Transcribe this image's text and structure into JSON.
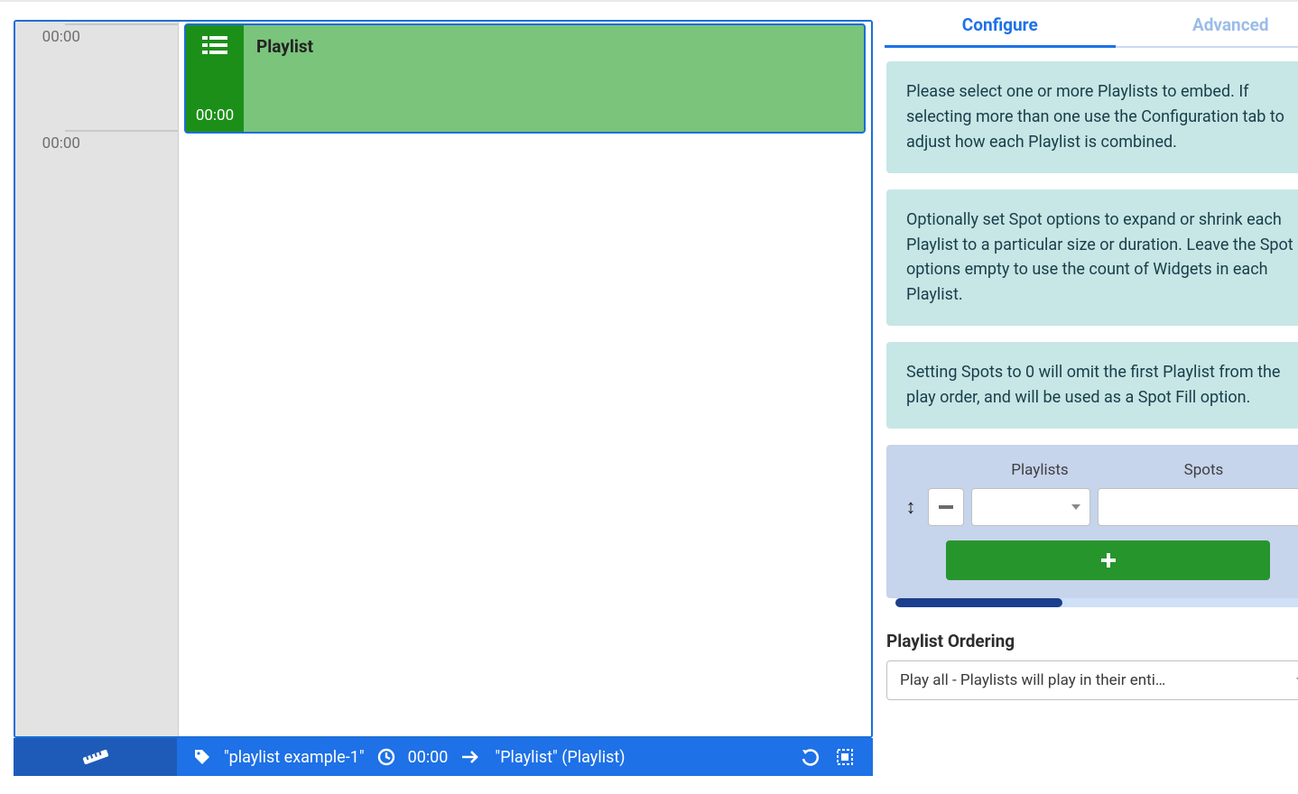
{
  "timeline": {
    "labels": [
      "00:00",
      "00:00"
    ],
    "widget": {
      "title": "Playlist",
      "duration": "00:00"
    }
  },
  "bottombar": {
    "tag": "\"playlist example-1\"",
    "duration": "00:00",
    "breadcrumb": "\"Playlist\" (Playlist)"
  },
  "tabs": {
    "configure": "Configure",
    "advanced": "Advanced"
  },
  "infoboxes": {
    "a": "Please select one or more Playlists to embed. If selecting more than one use the Configuration tab to adjust how each Playlist is combined.",
    "b": "Optionally set Spot options to expand or shrink each Playlist to a particular size or duration. Leave the Spot options empty to use the count of Widgets in each Playlist.",
    "c": "Setting Spots to 0 will omit the first Playlist from the play order, and will be used as a Spot Fill option."
  },
  "form": {
    "headers": {
      "playlists": "Playlists",
      "spots": "Spots"
    },
    "add_label": "+"
  },
  "section": {
    "ordering_title": "Playlist Ordering",
    "ordering_value": "Play all - Playlists will play in their enti…"
  }
}
